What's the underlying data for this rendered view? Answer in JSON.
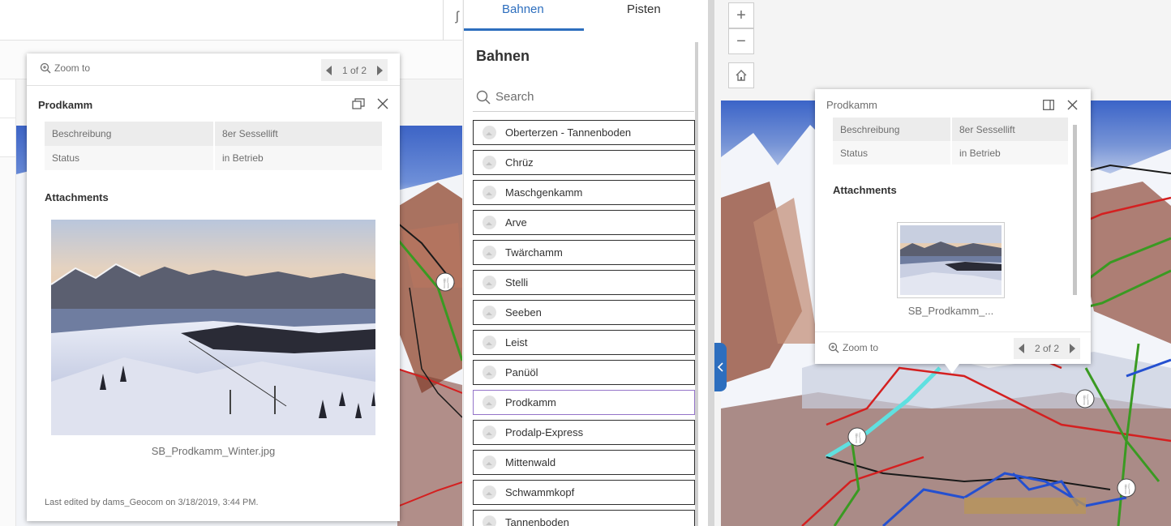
{
  "left_toolbar": {
    "glyph": "ʃ"
  },
  "popup1": {
    "zoom_label": "Zoom to",
    "pager": "1 of 2",
    "title": "Prodkamm",
    "attributes": [
      {
        "key": "Beschreibung",
        "value": "8er Sessellift"
      },
      {
        "key": "Status",
        "value": "in Betrieb"
      }
    ],
    "attachments_label": "Attachments",
    "attachment_caption": "SB_Prodkamm_Winter.jpg",
    "last_edited": "Last edited by dams_Geocom on 3/18/2019, 3:44 PM."
  },
  "list_panel": {
    "tabs": [
      "Bahnen",
      "Pisten"
    ],
    "active_tab": "Bahnen",
    "title": "Bahnen",
    "search_placeholder": "Search",
    "items": [
      {
        "label": "Oberterzen - Tannenboden"
      },
      {
        "label": "Chrüz"
      },
      {
        "label": "Maschgenkamm"
      },
      {
        "label": "Arve"
      },
      {
        "label": "Twärchamm"
      },
      {
        "label": "Stelli"
      },
      {
        "label": "Seeben"
      },
      {
        "label": "Leist"
      },
      {
        "label": "Panüöl"
      },
      {
        "label": "Prodkamm"
      },
      {
        "label": "Prodalp-Express"
      },
      {
        "label": "Mittenwald"
      },
      {
        "label": "Schwammkopf"
      },
      {
        "label": "Tannenboden"
      }
    ],
    "selected_item": "Prodkamm"
  },
  "map_controls": {
    "zoom_in": "+",
    "zoom_out": "−"
  },
  "popup2": {
    "title": "Prodkamm",
    "attributes": [
      {
        "key": "Beschreibung",
        "value": "8er Sessellift"
      },
      {
        "key": "Status",
        "value": "in Betrieb"
      }
    ],
    "attachments_label": "Attachments",
    "attachment_caption": "SB_Prodkamm_...",
    "zoom_label": "Zoom to",
    "pager": "2 of 2"
  },
  "colors": {
    "accent": "#2d6ebe",
    "selected_border": "#9474c8",
    "lift_green": "#3a9a22",
    "piste_red": "#d42020",
    "piste_blue": "#2450d0"
  }
}
